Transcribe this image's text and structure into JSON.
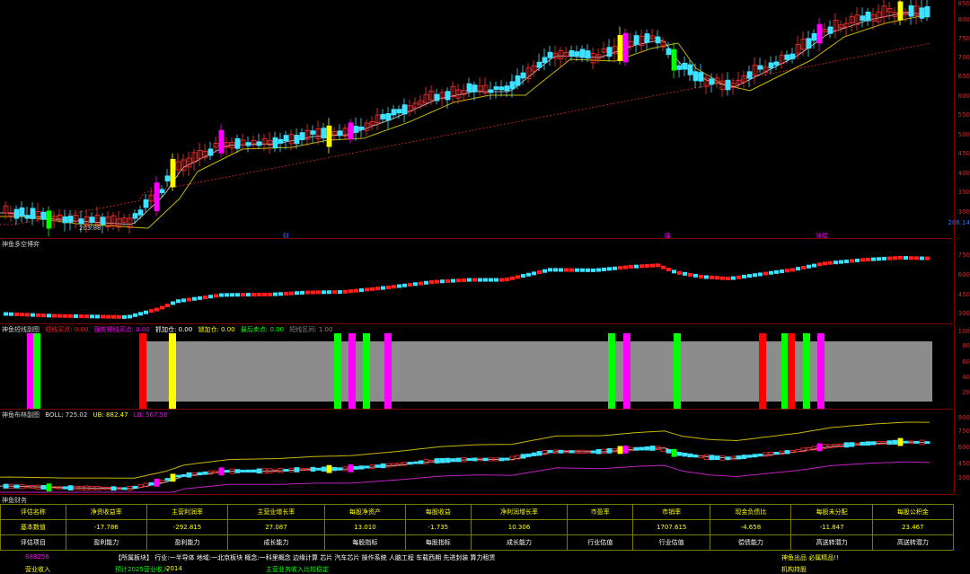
{
  "price_axis": [
    "850",
    "800",
    "750",
    "700",
    "650",
    "600",
    "550",
    "500",
    "450",
    "400",
    "350",
    "300",
    "250"
  ],
  "price_axis_marker": "206.14",
  "main_chart": {
    "low_label": "203.88",
    "markers": [
      {
        "text": "财",
        "color": "#3a6cff"
      },
      {
        "text": "降",
        "color": "#ff00ff"
      },
      {
        "text": "涨幅",
        "color": "#ff00ff"
      }
    ]
  },
  "pane2": {
    "title": "神鱼多空博弈",
    "axis": [
      "750",
      "600",
      "450",
      "300"
    ]
  },
  "pane3": {
    "labels": [
      {
        "text": "神鱼短线副图",
        "color": "#ccc"
      },
      {
        "text": "短线买点: 0.00",
        "color": "#ff2020"
      },
      {
        "text": "强势短线买点: 0.00",
        "color": "#ff00ff"
      },
      {
        "text": "抓加仓: 0.00",
        "color": "#ffffff"
      },
      {
        "text": "锁加仓: 0.00",
        "color": "#ffff00"
      },
      {
        "text": "最后卖点: 0.00",
        "color": "#00ff00"
      },
      {
        "text": "短线区间: 1.00",
        "color": "#888888"
      }
    ],
    "axis": [
      "100",
      "80",
      "60",
      "40",
      "20"
    ]
  },
  "pane4": {
    "labels": [
      {
        "text": "神鱼布林副图",
        "color": "#ccc"
      },
      {
        "text": "BOLL: 725.02",
        "color": "#dddddd"
      },
      {
        "text": "UB: 882.47",
        "color": "#ffff00"
      },
      {
        "text": "LB: 567.56",
        "color": "#ff00ff"
      }
    ],
    "axis": [
      "900",
      "750",
      "600",
      "450",
      "300"
    ]
  },
  "pane5": {
    "title": "神鱼财务"
  },
  "finance": {
    "headers": [
      "评估名称",
      "净资收益率",
      "主营利润率",
      "主营业增长率",
      "每股净资产",
      "每股收益",
      "净利润增长率",
      "市盈率",
      "市销率",
      "现金负债比",
      "每股未分配",
      "每股公积金"
    ],
    "basic_label": "基本数值",
    "values": [
      "-17.786",
      "-292.815",
      "27.087",
      "13.010",
      "-1.735",
      "10.306",
      "",
      "1707.615",
      "-4.658",
      "-11.847",
      "23.467"
    ],
    "eval_label": "评估项目",
    "items": [
      "盈利能力",
      "盈利能力",
      "成长能力",
      "每股指标",
      "每股指标",
      "成长能力",
      "行业估值",
      "行业估值",
      "偿债能力",
      "高送转潜力",
      "高送转潜力"
    ]
  },
  "news": {
    "code": "688256",
    "text": "【所属板块】 行业:一半导体 地域:一北京板块 概念:一科里概念 边缘计算 芯片 汽车芯片 操作系统 人脑工程 车载西期 先进封装 算力租赁",
    "right_text": "神鱼出品 必属精品!!",
    "line2_left": "营业收入",
    "line2_a": "预计2025营业收入",
    "line2_b": "2014",
    "line2_c": "主营业务收入比较稳定",
    "line2_d": "机构持股"
  }
}
